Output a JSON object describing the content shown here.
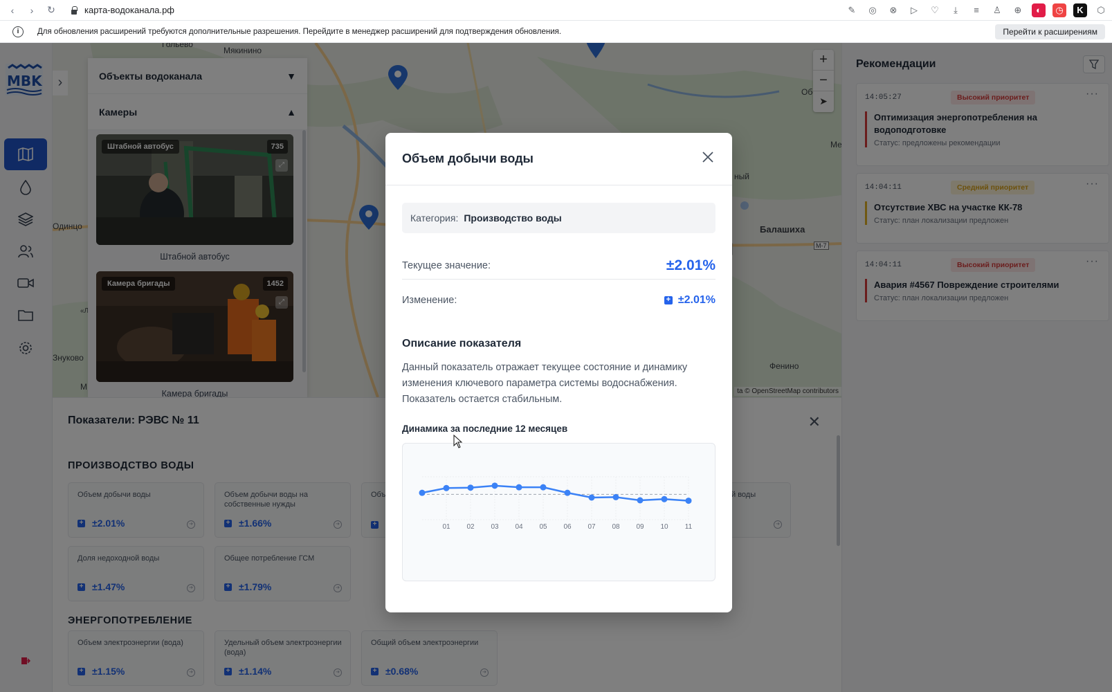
{
  "browser": {
    "url": "карта-водоканала.рф",
    "info_message": "Для обновления расширений требуются дополнительные разрешения. Перейдите в менеджер расширений для подтверждения обновления.",
    "info_button": "Перейти к расширениям"
  },
  "map": {
    "labels": [
      "Гольево",
      "Мякинино",
      "Одинцо",
      "Балашиха",
      "Фенино",
      "Знуково",
      "Обо",
      "Ме",
      "ный",
      "М-7",
      "«Л",
      "М"
    ],
    "attribution": "ta © OpenStreetMap contributors",
    "zoom_in": "+",
    "zoom_out": "−"
  },
  "cameras_panel": {
    "objects_title": "Объекты водоканала",
    "cameras_title": "Камеры",
    "cameras": [
      {
        "tag": "Штабной автобус",
        "count": "735",
        "caption": "Штабной автобус"
      },
      {
        "tag": "Камера бригады",
        "count": "1452",
        "caption": "Камера бригады"
      }
    ]
  },
  "recommendations": {
    "title": "Рекомендации",
    "items": [
      {
        "time": "14:05:27",
        "priority": "Высокий приоритет",
        "level": "high",
        "name": "Оптимизация энергопотребления на водоподготовке",
        "status": "Статус: предложены рекомендации"
      },
      {
        "time": "14:04:11",
        "priority": "Средний приоритет",
        "level": "mid",
        "name": "Отсутствие ХВС на участке КК-78",
        "status": "Статус: план локализации предложен"
      },
      {
        "time": "14:04:11",
        "priority": "Высокий приоритет",
        "level": "high",
        "name": "Авария #4567 Повреждение строителями",
        "status": "Статус: план локализации предложен"
      }
    ]
  },
  "indicators": {
    "title": "Показатели: РЭВС № 11",
    "sections": [
      {
        "title": "ПРОИЗВОДСТВО ВОДЫ"
      },
      {
        "title": "ЭНЕРГОПОТРЕБЛЕНИЕ"
      }
    ],
    "production_cards": [
      {
        "name": "Объем добычи воды",
        "value": "±2.01%"
      },
      {
        "name": "Объем добычи воды на собственные нужды",
        "value": "±1.66%"
      },
      {
        "name": "Объ",
        "value": ""
      },
      {
        "name": "й воды",
        "value": ""
      },
      {
        "name": "Доля недоходной воды",
        "value": "±1.47%"
      },
      {
        "name": "Общее потребление ГСМ",
        "value": "±1.79%"
      }
    ],
    "energy_cards": [
      {
        "name": "Объем электроэнергии (вода)",
        "value": "±1.15%"
      },
      {
        "name": "Удельный объем электроэнергии (вода)",
        "value": "±1.14%"
      },
      {
        "name": "Общий объем электроэнергии",
        "value": "±0.68%"
      }
    ]
  },
  "modal": {
    "title": "Объем добычи воды",
    "category_label": "Категория:",
    "category_value": "Производство воды",
    "current_label": "Текущее значение:",
    "current_value": "±2.01%",
    "change_label": "Изменение:",
    "change_value": "±2.01%",
    "description_title": "Описание показателя",
    "description": "Данный показатель отражает текущее состояние и динамику изменения ключевого параметра системы водоснабжения. Показатель остается стабильным.",
    "dynamics_title": "Динамика за последние 12 месяцев"
  },
  "chart_data": {
    "type": "line",
    "categories": [
      "",
      "01",
      "02",
      "03",
      "04",
      "05",
      "06",
      "07",
      "08",
      "09",
      "10",
      "11"
    ],
    "values": [
      2.02,
      2.14,
      2.15,
      2.2,
      2.16,
      2.16,
      2.02,
      1.9,
      1.91,
      1.83,
      1.86,
      1.82
    ],
    "ylim": [
      1.2,
      2.6
    ],
    "reference_line": 1.98,
    "title": "",
    "xlabel": "",
    "ylabel": "",
    "color": "#3b82f6"
  },
  "colors": {
    "accent": "#2563eb",
    "sidebar_active": "#2155c9",
    "high_priority": "#d63b3b",
    "mid_priority": "#e1b124"
  }
}
